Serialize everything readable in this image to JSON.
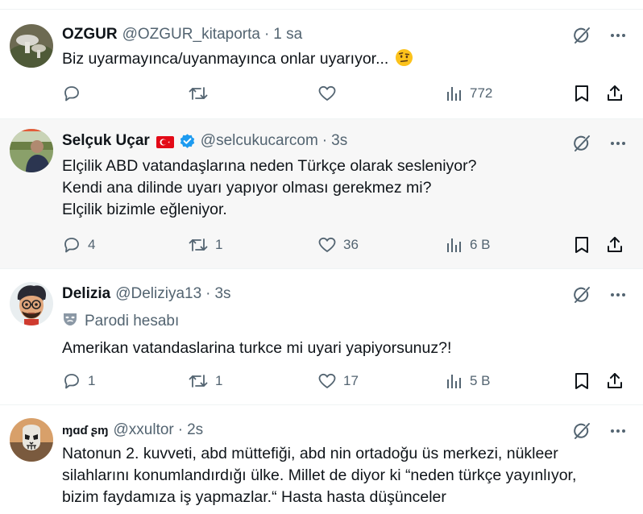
{
  "tweets": [
    {
      "name": "OZGUR",
      "handle": "@OZGUR_kitaporta",
      "sep": "·",
      "time": "1 sa",
      "lines": [
        "Biz uyarmayınca/uyanmayınca onlar uyarıyor..."
      ],
      "emoji": "face-with-raised-eyebrow",
      "stats": {
        "replies": "",
        "reposts": "",
        "likes": "",
        "views": "772"
      }
    },
    {
      "name": "Selçuk Uçar",
      "handle": "@selcukucarcom",
      "sep": "·",
      "time": "3s",
      "flag": "turkey-flag",
      "verified": true,
      "lines": [
        "Elçilik ABD vatandaşlarına neden Türkçe olarak sesleniyor?",
        "Kendi ana dilinde uyarı yapıyor olması gerekmez mi?",
        "Elçilik bizimle eğleniyor."
      ],
      "stats": {
        "replies": "4",
        "reposts": "1",
        "likes": "36",
        "views": "6 B"
      }
    },
    {
      "name": "Delizia",
      "handle": "@Deliziya13",
      "sep": "·",
      "time": "3s",
      "parody_label": "Parodi hesabı",
      "lines": [
        "Amerikan vatandaslarina turkce mi uyari yapiyorsunuz?!"
      ],
      "stats": {
        "replies": "1",
        "reposts": "1",
        "likes": "17",
        "views": "5 B"
      }
    },
    {
      "name": "ɱɑɗ ʂɱ",
      "handle": "@xxultor",
      "sep": "·",
      "time": "2s",
      "lines": [
        "Natonun 2. kuvveti, abd müttefiği, abd nin ortadoğu üs merkezi, nükleer",
        "silahlarını konumlandırdığı ülke. Millet de diyor ki “neden türkçe yayınlıyor,",
        "bizim faydamıza iş yapmazlar.“ Hasta hasta düşünceler"
      ]
    }
  ],
  "colors": {
    "text": "#0f1419",
    "secondary": "#536471",
    "verified": "#1d9bf0",
    "highlight_bg": "#f7f7f7",
    "divider": "#eff3f4"
  },
  "icons": [
    "reply-icon",
    "repost-icon",
    "like-icon",
    "views-icon",
    "bookmark-icon",
    "share-icon",
    "grok-icon",
    "more-icon",
    "mask-icon",
    "verified-badge-icon"
  ]
}
